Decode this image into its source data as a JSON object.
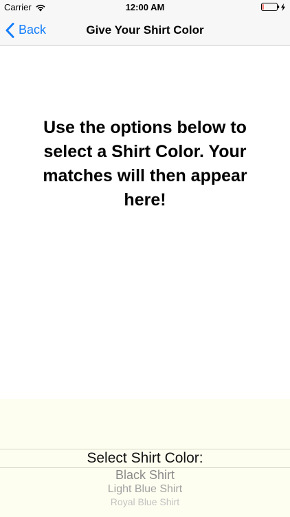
{
  "status_bar": {
    "carrier": "Carrier",
    "time": "12:00 AM",
    "wifi_icon": "wifi-icon",
    "battery_icon": "battery-icon",
    "charging_icon": "charging-bolt-icon",
    "battery_level": 0.08
  },
  "nav": {
    "back_label": "Back",
    "back_icon": "chevron-left-icon",
    "title": "Give Your Shirt Color",
    "accent_color": "#157efb"
  },
  "main": {
    "message": "Use the options below to select a Shirt Color. Your matches will then appear here!"
  },
  "picker": {
    "selected_label": "Select Shirt Color:",
    "options": [
      "Black Shirt",
      "Light Blue Shirt",
      "Royal Blue Shirt"
    ],
    "background_color": "#fefef0"
  }
}
